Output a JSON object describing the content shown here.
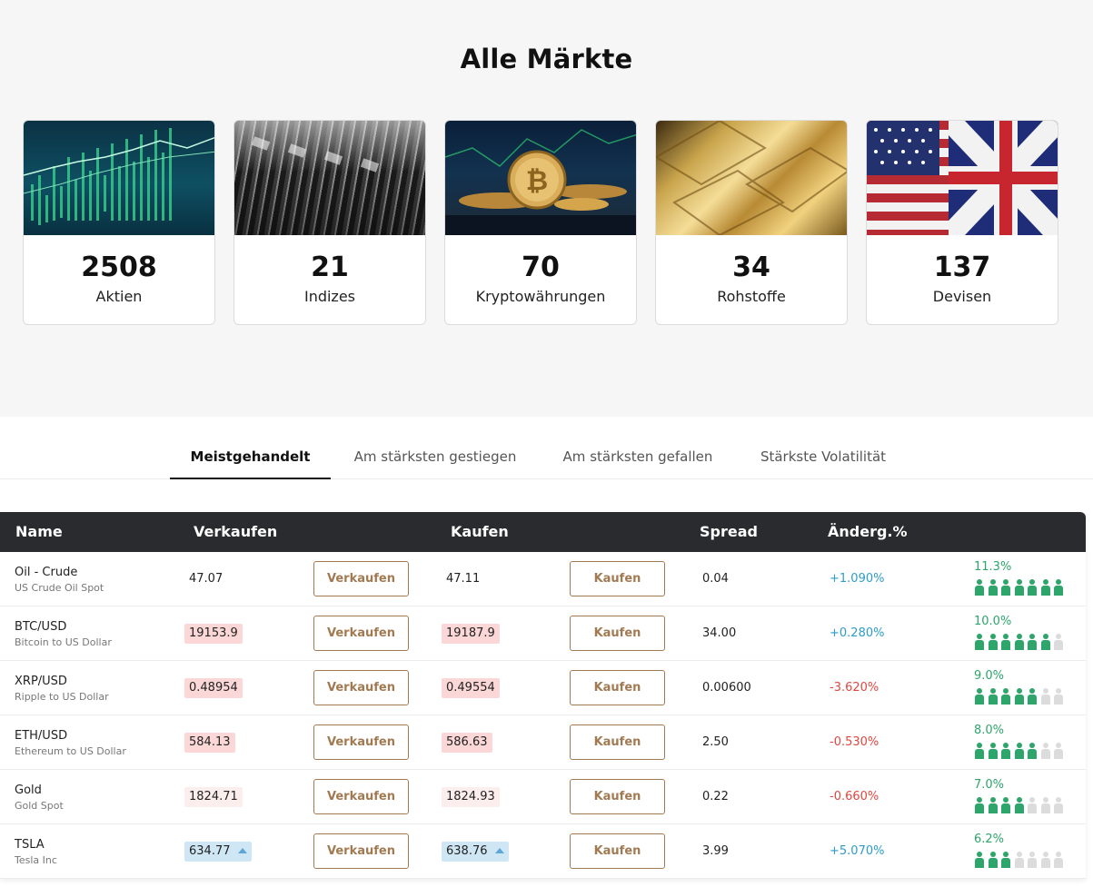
{
  "page_title": "Alle Märkte",
  "categories": [
    {
      "count": "2508",
      "label": "Aktien",
      "image": "stocks-chart-image"
    },
    {
      "count": "21",
      "label": "Indizes",
      "image": "dow-jones-image"
    },
    {
      "count": "70",
      "label": "Kryptowährungen",
      "image": "bitcoin-image"
    },
    {
      "count": "34",
      "label": "Rohstoffe",
      "image": "gold-bars-image"
    },
    {
      "count": "137",
      "label": "Devisen",
      "image": "us-uk-flags-image"
    }
  ],
  "tabs": [
    {
      "label": "Meistgehandelt",
      "active": true
    },
    {
      "label": "Am stärksten gestiegen",
      "active": false
    },
    {
      "label": "Am stärksten gefallen",
      "active": false
    },
    {
      "label": "Stärkste Volatilität",
      "active": false
    }
  ],
  "table": {
    "headers": {
      "name": "Name",
      "sell": "Verkaufen",
      "buy": "Kaufen",
      "spread": "Spread",
      "change": "Änderg.%"
    },
    "sell_button_label": "Verkaufen",
    "buy_button_label": "Kaufen",
    "rows": [
      {
        "name": "Oil - Crude",
        "desc": "US Crude Oil Spot",
        "sell": "47.07",
        "sell_state": "plain",
        "buy": "47.11",
        "buy_state": "plain",
        "spread": "0.04",
        "change": "+1.090%",
        "change_dir": "pos",
        "sentiment": "11.3%",
        "sentiment_level": 7
      },
      {
        "name": "BTC/USD",
        "desc": "Bitcoin to US Dollar",
        "sell": "19153.9",
        "sell_state": "down",
        "buy": "19187.9",
        "buy_state": "down",
        "spread": "34.00",
        "change": "+0.280%",
        "change_dir": "pos",
        "sentiment": "10.0%",
        "sentiment_level": 6
      },
      {
        "name": "XRP/USD",
        "desc": "Ripple to US Dollar",
        "sell": "0.48954",
        "sell_state": "down",
        "buy": "0.49554",
        "buy_state": "down",
        "spread": "0.00600",
        "change": "-3.620%",
        "change_dir": "neg",
        "sentiment": "9.0%",
        "sentiment_level": 5
      },
      {
        "name": "ETH/USD",
        "desc": "Ethereum to US Dollar",
        "sell": "584.13",
        "sell_state": "down",
        "buy": "586.63",
        "buy_state": "down",
        "spread": "2.50",
        "change": "-0.530%",
        "change_dir": "neg",
        "sentiment": "8.0%",
        "sentiment_level": 5
      },
      {
        "name": "Gold",
        "desc": "Gold Spot",
        "sell": "1824.71",
        "sell_state": "flat",
        "buy": "1824.93",
        "buy_state": "flat",
        "spread": "0.22",
        "change": "-0.660%",
        "change_dir": "neg",
        "sentiment": "7.0%",
        "sentiment_level": 4
      },
      {
        "name": "TSLA",
        "desc": "Tesla Inc",
        "sell": "634.77",
        "sell_state": "up",
        "buy": "638.76",
        "buy_state": "up",
        "spread": "3.99",
        "change": "+5.070%",
        "change_dir": "pos",
        "sentiment": "6.2%",
        "sentiment_level": 3
      }
    ]
  },
  "colors": {
    "accent": "#a27a52",
    "positive": "#2e9cc9",
    "negative": "#e0473f",
    "sentiment": "#2ea56b",
    "header_bg": "#2a2b2e"
  }
}
